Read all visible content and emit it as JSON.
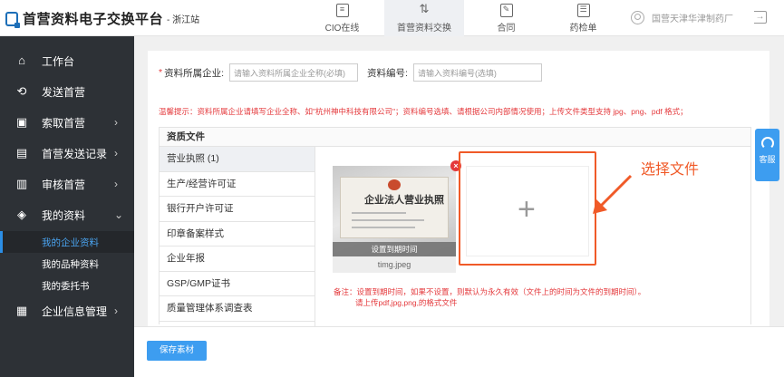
{
  "header": {
    "title": "首营资料电子交换平台",
    "site": "- 浙江站",
    "nav": [
      {
        "label": "CIO在线",
        "icon": "document-icon"
      },
      {
        "label": "首营资料交换",
        "icon": "exchange-icon"
      },
      {
        "label": "合同",
        "icon": "contract-icon"
      },
      {
        "label": "药检单",
        "icon": "report-icon"
      }
    ],
    "user": "国营天津华津制药厂"
  },
  "sidebar": {
    "items": [
      {
        "label": "工作台",
        "icon": "home-icon"
      },
      {
        "label": "发送首营",
        "icon": "send-icon"
      },
      {
        "label": "索取首营",
        "icon": "request-icon",
        "chevron": "›"
      },
      {
        "label": "首营发送记录",
        "icon": "record-icon",
        "chevron": "›"
      },
      {
        "label": "审核首营",
        "icon": "audit-icon",
        "chevron": "›"
      },
      {
        "label": "我的资料",
        "icon": "layers-icon",
        "chevron": "⌄"
      },
      {
        "label": "企业信息管理",
        "icon": "building-icon",
        "chevron": "›"
      }
    ],
    "sub_items": [
      {
        "label": "我的企业资料"
      },
      {
        "label": "我的品种资料"
      },
      {
        "label": "我的委托书"
      }
    ]
  },
  "form": {
    "company_label": "资料所属企业:",
    "company_placeholder": "请输入资料所属企业全称(必填)",
    "code_label": "资料编号:",
    "code_placeholder": "请输入资料编号(选填)",
    "tip": "温馨提示：资料所属企业请填写企业全称、如\"杭州神中科技有限公司\"；资料编号选填、请根据公司内部情况使用；上传文件类型支持 jpg、png、pdf 格式；"
  },
  "panel": {
    "title": "资质文件",
    "categories": [
      "营业执照 (1)",
      "生产/经营许可证",
      "银行开户许可证",
      "印章备案样式",
      "企业年报",
      "GSP/GMP证书",
      "质量管理体系调查表"
    ],
    "thumb": {
      "card_text": "企业法人营业执照",
      "overlay": "设置到期时间",
      "filename": "timg.jpeg"
    },
    "upload_plus": "+",
    "annotation": "选择文件",
    "note_line1": "备注：设置到期时间，如果不设置，则默认为永久有效（文件上的时间为文件的到期时间）。",
    "note_line2": "请上传pdf,jpg,png,的格式文件"
  },
  "footer": {
    "save_label": "保存素材"
  },
  "service": {
    "label": "客服"
  },
  "colors": {
    "accent": "#3d9df0",
    "sidebar_bg": "#2d3136",
    "danger": "#e4393c",
    "highlight": "#f05a28"
  }
}
